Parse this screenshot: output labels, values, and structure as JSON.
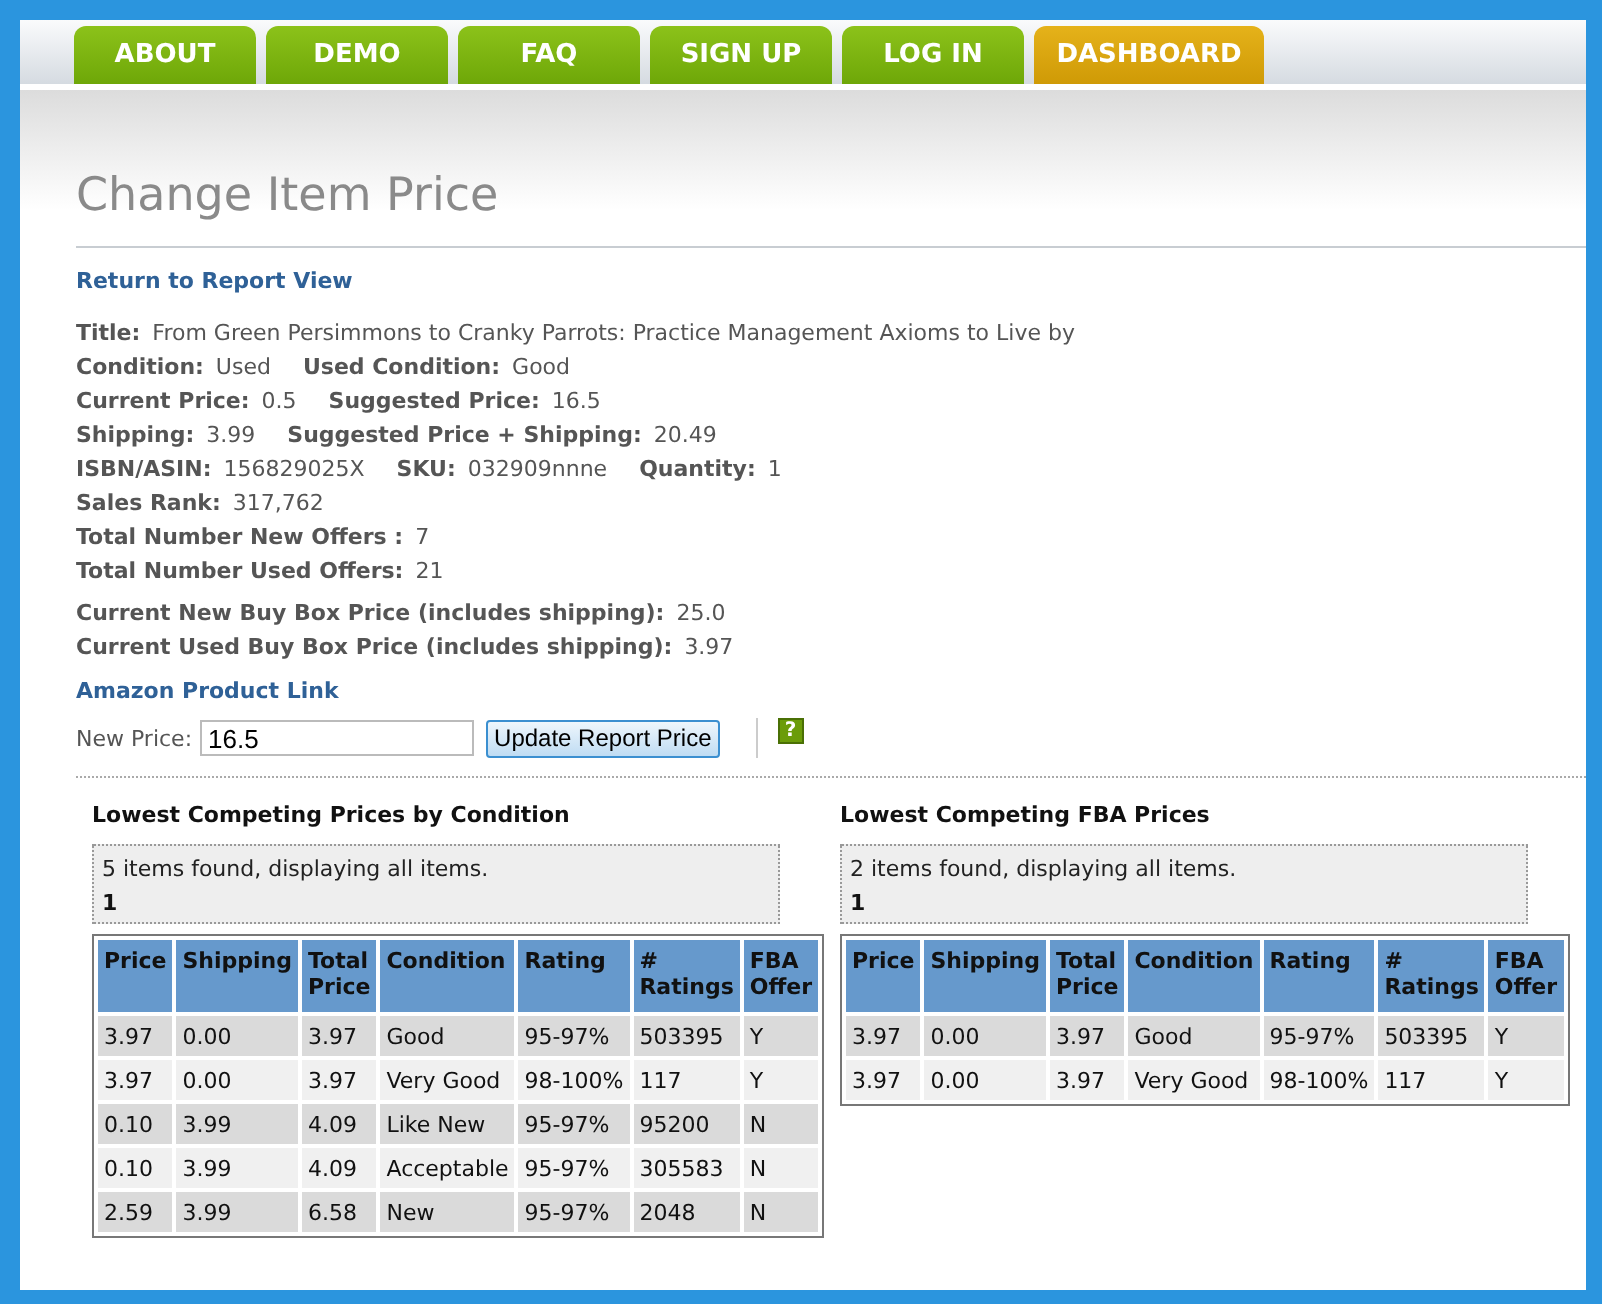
{
  "nav": [
    {
      "label": "ABOUT",
      "selected": false
    },
    {
      "label": "DEMO",
      "selected": false
    },
    {
      "label": "FAQ",
      "selected": false
    },
    {
      "label": "SIGN UP",
      "selected": false
    },
    {
      "label": "LOG IN",
      "selected": false
    },
    {
      "label": "DASHBOARD",
      "selected": true
    }
  ],
  "heading": "Change Item Price",
  "return_link": "Return to Report View",
  "details": [
    [
      {
        "label": "Title:",
        "value": "From Green Persimmons to Cranky Parrots: Practice Management Axioms to Live by"
      }
    ],
    [
      {
        "label": "Condition:",
        "value": "Used"
      },
      {
        "label": "Used Condition:",
        "value": "Good"
      }
    ],
    [
      {
        "label": "Current Price:",
        "value": "0.5"
      },
      {
        "label": "Suggested Price:",
        "value": "16.5"
      }
    ],
    [
      {
        "label": "Shipping:",
        "value": "3.99"
      },
      {
        "label": "Suggested Price + Shipping:",
        "value": "20.49"
      }
    ],
    [
      {
        "label": "ISBN/ASIN:",
        "value": "156829025X"
      },
      {
        "label": "SKU:",
        "value": "032909nnne"
      },
      {
        "label": "Quantity:",
        "value": "1"
      }
    ],
    [
      {
        "label": "Sales Rank:",
        "value": "317,762"
      }
    ],
    [
      {
        "label": "Total Number New Offers :",
        "value": "7"
      }
    ],
    [
      {
        "label": "Total Number Used Offers:",
        "value": "21"
      }
    ]
  ],
  "buy_box": [
    {
      "label": "Current New Buy Box Price (includes shipping):",
      "value": "25.0"
    },
    {
      "label": "Current Used Buy Box Price (includes shipping):",
      "value": "3.97"
    }
  ],
  "product_link": "Amazon Product Link",
  "new_price": {
    "label": "New Price:",
    "value": "16.5",
    "button": "Update Report Price",
    "help": "?"
  },
  "tables": [
    {
      "title": "Lowest Competing Prices by Condition",
      "summary": "5 items found, displaying all items.",
      "page": "1",
      "columns": [
        "Price",
        "Shipping",
        "Total Price",
        "Condition",
        "Rating",
        "# Ratings",
        "FBA Offer"
      ],
      "rows": [
        [
          "3.97",
          "0.00",
          "3.97",
          "Good",
          "95-97%",
          "503395",
          "Y"
        ],
        [
          "3.97",
          "0.00",
          "3.97",
          "Very Good",
          "98-100%",
          "117",
          "Y"
        ],
        [
          "0.10",
          "3.99",
          "4.09",
          "Like New",
          "95-97%",
          "95200",
          "N"
        ],
        [
          "0.10",
          "3.99",
          "4.09",
          "Acceptable",
          "95-97%",
          "305583",
          "N"
        ],
        [
          "2.59",
          "3.99",
          "6.58",
          "New",
          "95-97%",
          "2048",
          "N"
        ]
      ]
    },
    {
      "title": "Lowest Competing FBA Prices",
      "summary": "2 items found, displaying all items.",
      "page": "1",
      "columns": [
        "Price",
        "Shipping",
        "Total Price",
        "Condition",
        "Rating",
        "# Ratings",
        "FBA Offer"
      ],
      "rows": [
        [
          "3.97",
          "0.00",
          "3.97",
          "Good",
          "95-97%",
          "503395",
          "Y"
        ],
        [
          "3.97",
          "0.00",
          "3.97",
          "Very Good",
          "98-100%",
          "117",
          "Y"
        ]
      ]
    }
  ]
}
